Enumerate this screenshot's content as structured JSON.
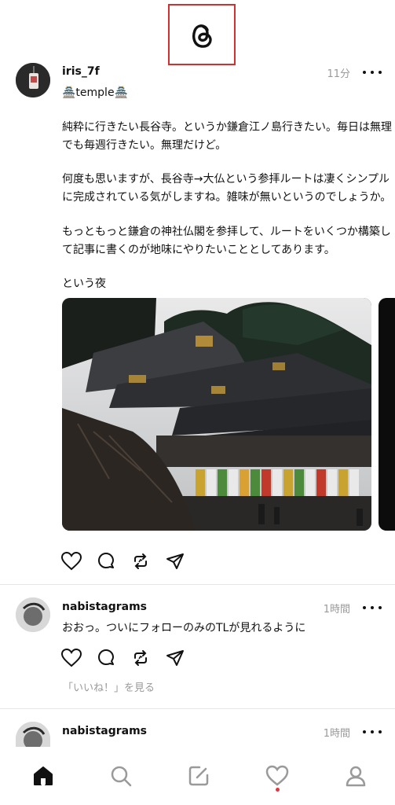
{
  "app": {
    "logo": "threads-logo-icon",
    "accent": "#e8323c"
  },
  "posts": [
    {
      "username": "iris_7f",
      "time": "11分",
      "tag": "🏯temple🏯",
      "paragraphs": [
        "純粋に行きたい長谷寺。というか鎌倉江ノ島行きたい。毎日は無理\nでも毎週行きたい。無理だけど。",
        "何度も思いますが、長谷寺→大仏という参拝ルートは凄くシンプル\nに完成されている気がしますね。雑味が無いというのでしょうか。",
        "もっともっと鎌倉の神社仏閣を参拝して、ルートをいくつか構築し\nて記事に書くのが地味にやりたいこととしてあります。",
        "という夜"
      ],
      "image": "temple-photo"
    },
    {
      "username": "nabistagrams",
      "time": "1時間",
      "text": "おおっ。ついにフォローのみのTLが見れるように",
      "likes_link": "「いいね！」を見る"
    },
    {
      "username": "nabistagrams",
      "time": "1時間"
    }
  ],
  "tabbar": {
    "items": [
      "home-icon",
      "search-icon",
      "compose-icon",
      "heart-icon",
      "profile-icon"
    ]
  }
}
